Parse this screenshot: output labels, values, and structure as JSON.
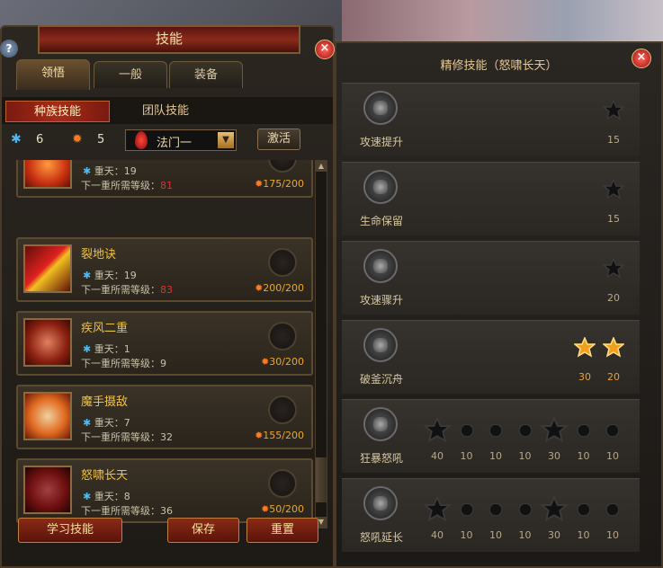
{
  "left_panel": {
    "title": "技能",
    "help_label": "?",
    "close_label": "×",
    "tabs": [
      "领悟",
      "一般",
      "装备"
    ],
    "subtabs": [
      "种族技能",
      "团队技能"
    ],
    "status": {
      "count1": "6",
      "count2": "5",
      "select_value": "法门一",
      "select_arrow": "▼",
      "activate_label": "激活"
    },
    "skills": [
      {
        "name": "",
        "line1": "重天：19",
        "line2_prefix": "下一重所需等级：",
        "line2_value": "81",
        "points": "175/200",
        "color": "#c83010"
      },
      {
        "name": "裂地诀",
        "line1": "重天：19",
        "line2_prefix": "下一重所需等级：",
        "line2_value": "83",
        "points": "200/200",
        "color": "#d02020"
      },
      {
        "name": "疾风二重",
        "line1": "重天：1",
        "line2_prefix": "下一重所需等级：",
        "line2_value": "9",
        "points": "30/200",
        "color": "#b84020"
      },
      {
        "name": "魔手摄敌",
        "line1": "重天：7",
        "line2_prefix": "下一重所需等级：",
        "line2_value": "32",
        "points": "155/200",
        "color": "#e06a20"
      },
      {
        "name": "怒啸长天",
        "line1": "重天：8",
        "line2_prefix": "下一重所需等级：",
        "line2_value": "36",
        "points": "50/200",
        "color": "#901818"
      }
    ],
    "footer": {
      "learn_label": "学习技能",
      "save_label": "保存",
      "reset_label": "重置"
    }
  },
  "right_panel": {
    "title": "精修技能（怒啸长天）",
    "close_label": "×",
    "refinements": [
      {
        "name": "攻速提升",
        "stars": [
          {
            "value": "15",
            "lit": false,
            "big": false
          }
        ]
      },
      {
        "name": "生命保留",
        "stars": [
          {
            "value": "15",
            "lit": false,
            "big": false
          }
        ]
      },
      {
        "name": "攻速骤升",
        "stars": [
          {
            "value": "20",
            "lit": false,
            "big": false
          }
        ]
      },
      {
        "name": "破釜沉舟",
        "stars": [
          {
            "value": "30",
            "lit": true,
            "big": false
          },
          {
            "value": "20",
            "lit": true,
            "big": false
          }
        ]
      },
      {
        "name": "狂暴怒吼",
        "stars": [
          {
            "value": "40",
            "lit": false,
            "big": true
          },
          {
            "value": "10",
            "lit": false,
            "big": false
          },
          {
            "value": "10",
            "lit": false,
            "big": false
          },
          {
            "value": "10",
            "lit": false,
            "big": false
          },
          {
            "value": "30",
            "lit": false,
            "big": true
          },
          {
            "value": "10",
            "lit": false,
            "big": false
          },
          {
            "value": "10",
            "lit": false,
            "big": false
          }
        ]
      },
      {
        "name": "怒吼延长",
        "stars": [
          {
            "value": "40",
            "lit": false,
            "big": true
          },
          {
            "value": "10",
            "lit": false,
            "big": false
          },
          {
            "value": "10",
            "lit": false,
            "big": false
          },
          {
            "value": "10",
            "lit": false,
            "big": false
          },
          {
            "value": "30",
            "lit": false,
            "big": true
          },
          {
            "value": "10",
            "lit": false,
            "big": false
          },
          {
            "value": "10",
            "lit": false,
            "big": false
          }
        ]
      }
    ]
  },
  "colors": {
    "accent": "#f0c040",
    "red": "#e03030",
    "points": "#e8a830"
  }
}
